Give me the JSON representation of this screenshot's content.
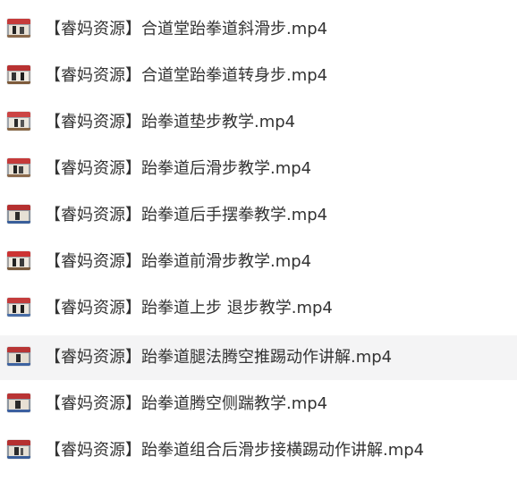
{
  "files": [
    {
      "name": "【睿妈资源】合道堂跆拳道斜滑步.mp4",
      "thumb": "video-thumbnail-icon"
    },
    {
      "name": "【睿妈资源】合道堂跆拳道转身步.mp4",
      "thumb": "video-thumbnail-icon"
    },
    {
      "name": "【睿妈资源】跆拳道垫步教学.mp4",
      "thumb": "video-thumbnail-icon"
    },
    {
      "name": "【睿妈资源】跆拳道后滑步教学.mp4",
      "thumb": "video-thumbnail-icon"
    },
    {
      "name": "【睿妈资源】跆拳道后手摆拳教学.mp4",
      "thumb": "video-thumbnail-icon"
    },
    {
      "name": "【睿妈资源】跆拳道前滑步教学.mp4",
      "thumb": "video-thumbnail-icon"
    },
    {
      "name": "【睿妈资源】跆拳道上步 退步教学.mp4",
      "thumb": "video-thumbnail-icon"
    },
    {
      "name": "【睿妈资源】跆拳道腿法腾空推踢动作讲解.mp4",
      "thumb": "video-thumbnail-icon"
    },
    {
      "name": "【睿妈资源】跆拳道腾空侧踹教学.mp4",
      "thumb": "video-thumbnail-icon"
    },
    {
      "name": "【睿妈资源】跆拳道组合后滑步接横踢动作讲解.mp4",
      "thumb": "video-thumbnail-icon"
    }
  ],
  "hovered_row": 7,
  "colors": {
    "text": "#333333",
    "hover_bg": "#f4f4f5"
  }
}
